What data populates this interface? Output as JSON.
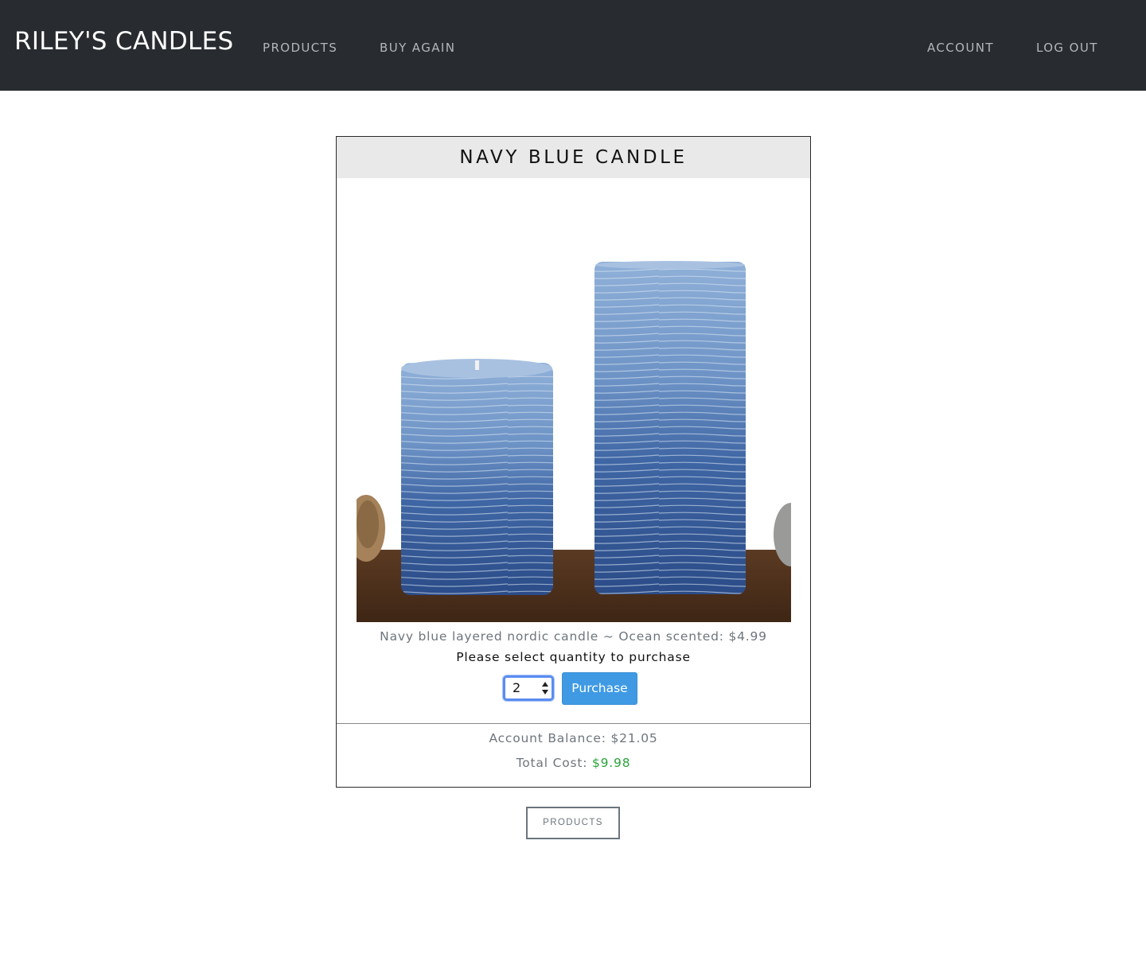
{
  "navbar": {
    "brand": "RILEY'S CANDLES",
    "links": [
      "PRODUCTS",
      "BUY AGAIN"
    ],
    "right_links": [
      "ACCOUNT",
      "LOG OUT"
    ]
  },
  "product": {
    "title": "NAVY BLUE CANDLE",
    "image_icon": "navy-blue-pillar-candles-photo",
    "description": "Navy blue layered nordic candle ~ Ocean scented: $4.99",
    "prompt": "Please select quantity to purchase",
    "quantity": "2",
    "purchase_label": "Purchase"
  },
  "summary": {
    "balance_text": "Account Balance: $21.05",
    "total_label": "Total Cost: ",
    "total_value": "$9.98"
  },
  "footer": {
    "products_label": "PRODUCTS"
  },
  "colors": {
    "navbar": "#282c30",
    "accent": "#3f9ae3",
    "total": "#2aa23a"
  }
}
